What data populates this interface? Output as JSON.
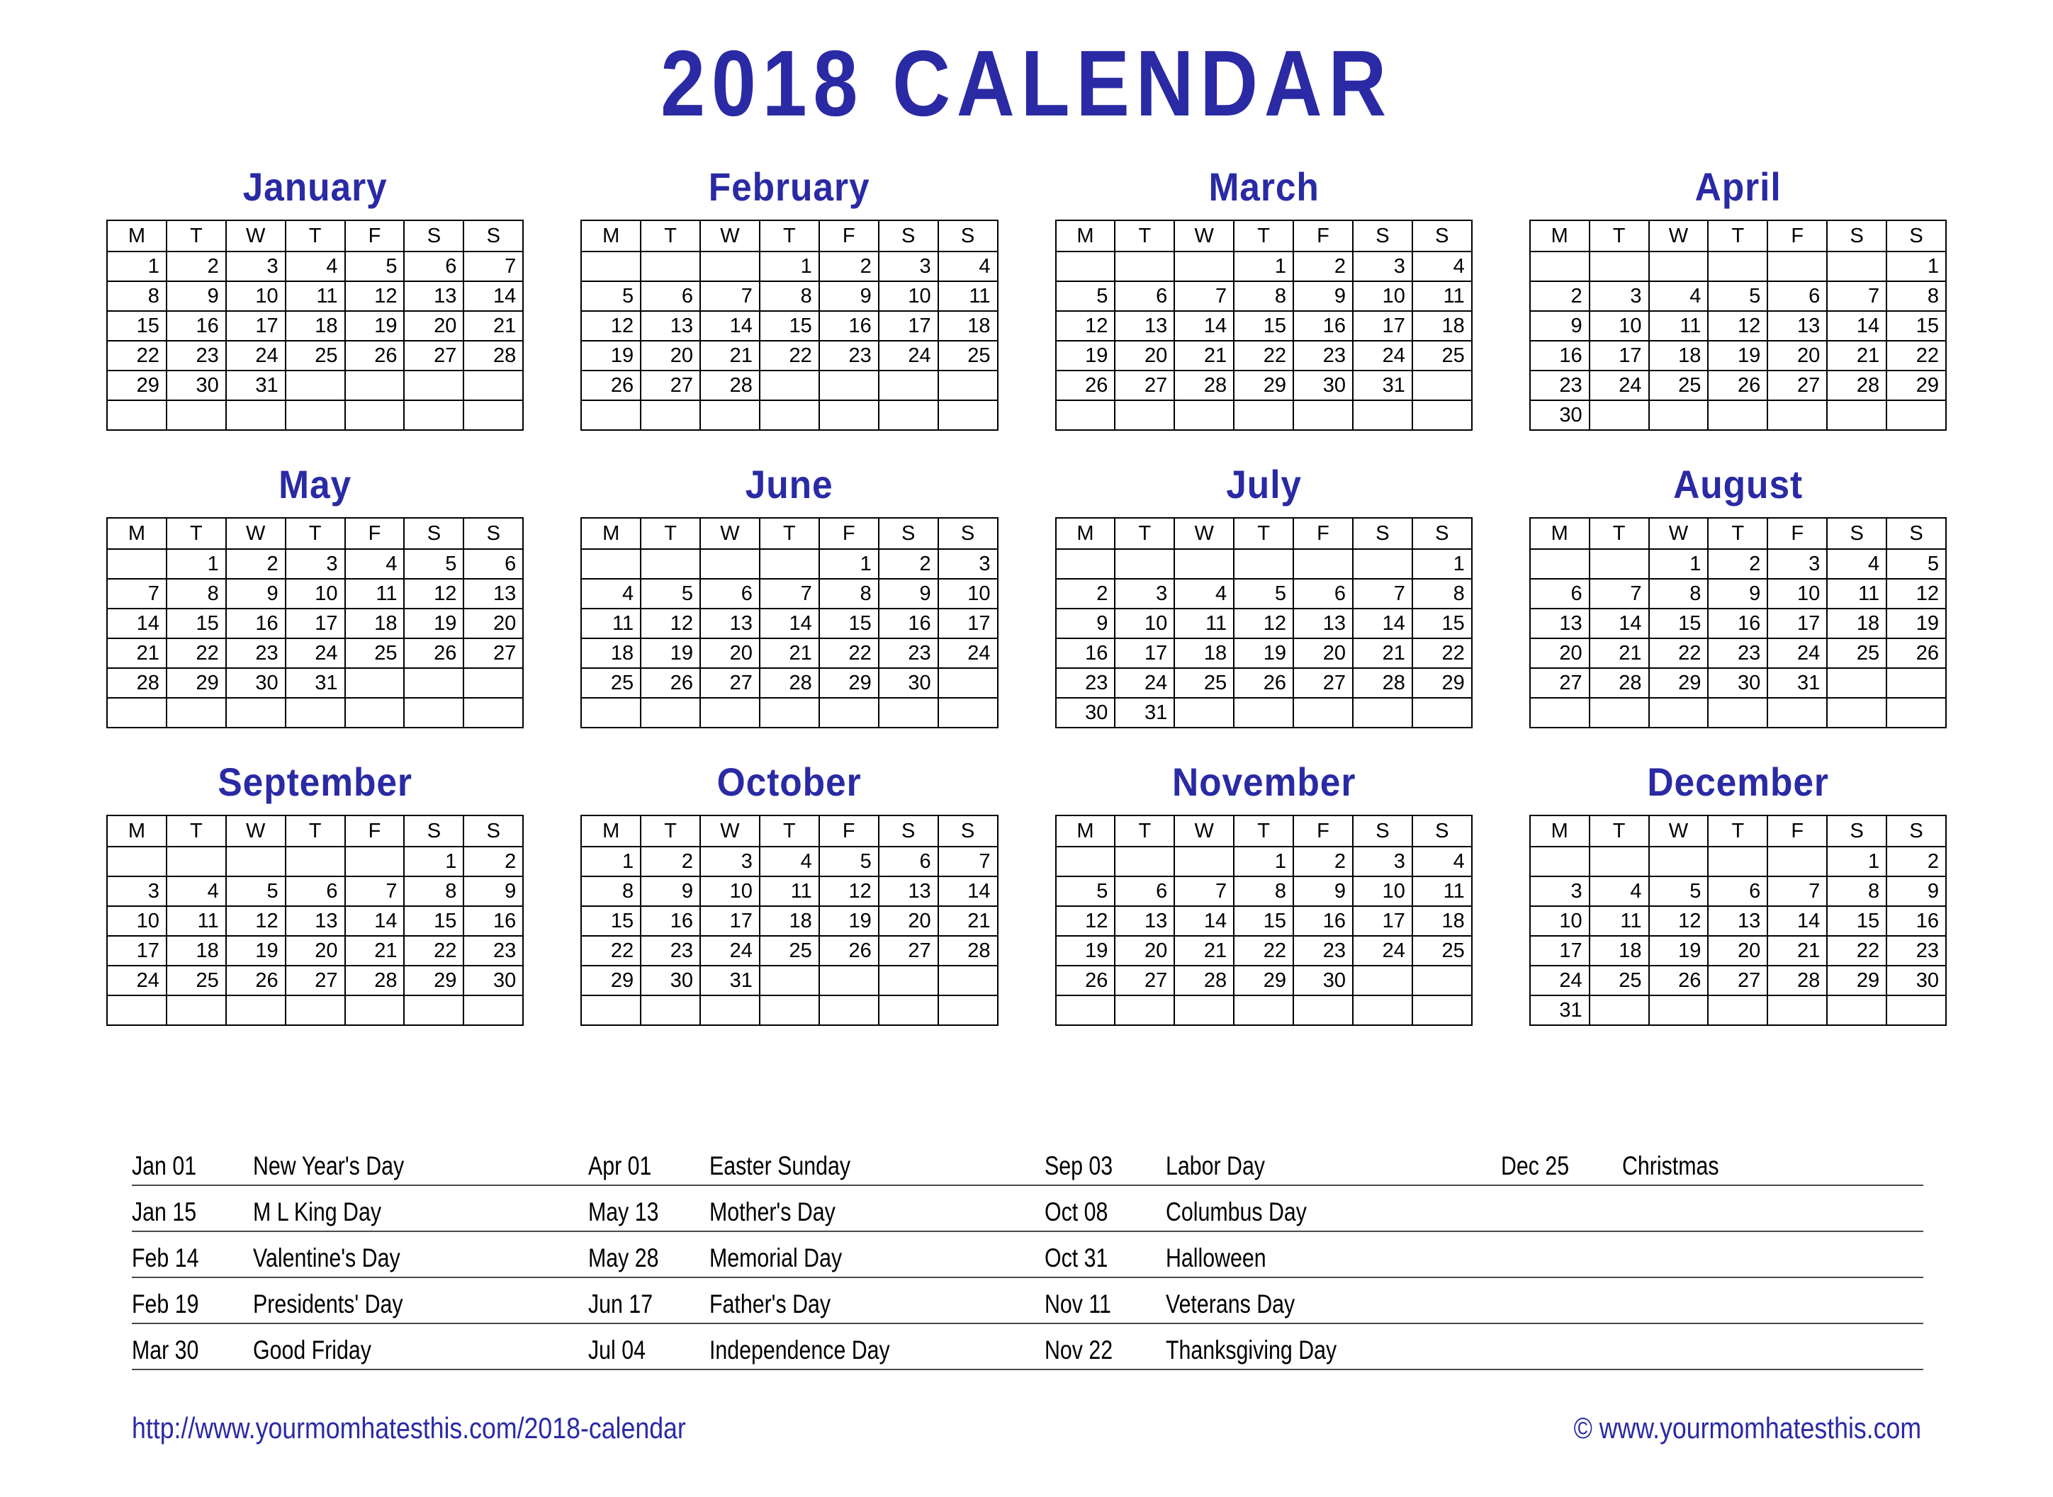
{
  "title": "2018 CALENDAR",
  "weekday_headers": [
    "M",
    "T",
    "W",
    "T",
    "F",
    "S",
    "S"
  ],
  "accent_color": "#2A2AA5",
  "border_color": "#000000",
  "months": [
    {
      "name": "January",
      "weeks": [
        [
          "1",
          "2",
          "3",
          "4",
          "5",
          "6",
          "7"
        ],
        [
          "8",
          "9",
          "10",
          "11",
          "12",
          "13",
          "14"
        ],
        [
          "15",
          "16",
          "17",
          "18",
          "19",
          "20",
          "21"
        ],
        [
          "22",
          "23",
          "24",
          "25",
          "26",
          "27",
          "28"
        ],
        [
          "29",
          "30",
          "31",
          "",
          "",
          "",
          ""
        ],
        [
          "",
          "",
          "",
          "",
          "",
          "",
          ""
        ]
      ]
    },
    {
      "name": "February",
      "weeks": [
        [
          "",
          "",
          "",
          "1",
          "2",
          "3",
          "4"
        ],
        [
          "5",
          "6",
          "7",
          "8",
          "9",
          "10",
          "11"
        ],
        [
          "12",
          "13",
          "14",
          "15",
          "16",
          "17",
          "18"
        ],
        [
          "19",
          "20",
          "21",
          "22",
          "23",
          "24",
          "25"
        ],
        [
          "26",
          "27",
          "28",
          "",
          "",
          "",
          ""
        ],
        [
          "",
          "",
          "",
          "",
          "",
          "",
          ""
        ]
      ]
    },
    {
      "name": "March",
      "weeks": [
        [
          "",
          "",
          "",
          "1",
          "2",
          "3",
          "4"
        ],
        [
          "5",
          "6",
          "7",
          "8",
          "9",
          "10",
          "11"
        ],
        [
          "12",
          "13",
          "14",
          "15",
          "16",
          "17",
          "18"
        ],
        [
          "19",
          "20",
          "21",
          "22",
          "23",
          "24",
          "25"
        ],
        [
          "26",
          "27",
          "28",
          "29",
          "30",
          "31",
          ""
        ],
        [
          "",
          "",
          "",
          "",
          "",
          "",
          ""
        ]
      ]
    },
    {
      "name": "April",
      "weeks": [
        [
          "",
          "",
          "",
          "",
          "",
          "",
          "1"
        ],
        [
          "2",
          "3",
          "4",
          "5",
          "6",
          "7",
          "8"
        ],
        [
          "9",
          "10",
          "11",
          "12",
          "13",
          "14",
          "15"
        ],
        [
          "16",
          "17",
          "18",
          "19",
          "20",
          "21",
          "22"
        ],
        [
          "23",
          "24",
          "25",
          "26",
          "27",
          "28",
          "29"
        ],
        [
          "30",
          "",
          "",
          "",
          "",
          "",
          ""
        ]
      ]
    },
    {
      "name": "May",
      "weeks": [
        [
          "",
          "1",
          "2",
          "3",
          "4",
          "5",
          "6"
        ],
        [
          "7",
          "8",
          "9",
          "10",
          "11",
          "12",
          "13"
        ],
        [
          "14",
          "15",
          "16",
          "17",
          "18",
          "19",
          "20"
        ],
        [
          "21",
          "22",
          "23",
          "24",
          "25",
          "26",
          "27"
        ],
        [
          "28",
          "29",
          "30",
          "31",
          "",
          "",
          ""
        ],
        [
          "",
          "",
          "",
          "",
          "",
          "",
          ""
        ]
      ]
    },
    {
      "name": "June",
      "weeks": [
        [
          "",
          "",
          "",
          "",
          "1",
          "2",
          "3"
        ],
        [
          "4",
          "5",
          "6",
          "7",
          "8",
          "9",
          "10"
        ],
        [
          "11",
          "12",
          "13",
          "14",
          "15",
          "16",
          "17"
        ],
        [
          "18",
          "19",
          "20",
          "21",
          "22",
          "23",
          "24"
        ],
        [
          "25",
          "26",
          "27",
          "28",
          "29",
          "30",
          ""
        ],
        [
          "",
          "",
          "",
          "",
          "",
          "",
          ""
        ]
      ]
    },
    {
      "name": "July",
      "weeks": [
        [
          "",
          "",
          "",
          "",
          "",
          "",
          "1"
        ],
        [
          "2",
          "3",
          "4",
          "5",
          "6",
          "7",
          "8"
        ],
        [
          "9",
          "10",
          "11",
          "12",
          "13",
          "14",
          "15"
        ],
        [
          "16",
          "17",
          "18",
          "19",
          "20",
          "21",
          "22"
        ],
        [
          "23",
          "24",
          "25",
          "26",
          "27",
          "28",
          "29"
        ],
        [
          "30",
          "31",
          "",
          "",
          "",
          "",
          ""
        ]
      ]
    },
    {
      "name": "August",
      "weeks": [
        [
          "",
          "",
          "1",
          "2",
          "3",
          "4",
          "5"
        ],
        [
          "6",
          "7",
          "8",
          "9",
          "10",
          "11",
          "12"
        ],
        [
          "13",
          "14",
          "15",
          "16",
          "17",
          "18",
          "19"
        ],
        [
          "20",
          "21",
          "22",
          "23",
          "24",
          "25",
          "26"
        ],
        [
          "27",
          "28",
          "29",
          "30",
          "31",
          "",
          ""
        ],
        [
          "",
          "",
          "",
          "",
          "",
          "",
          ""
        ]
      ]
    },
    {
      "name": "September",
      "weeks": [
        [
          "",
          "",
          "",
          "",
          "",
          "1",
          "2"
        ],
        [
          "3",
          "4",
          "5",
          "6",
          "7",
          "8",
          "9"
        ],
        [
          "10",
          "11",
          "12",
          "13",
          "14",
          "15",
          "16"
        ],
        [
          "17",
          "18",
          "19",
          "20",
          "21",
          "22",
          "23"
        ],
        [
          "24",
          "25",
          "26",
          "27",
          "28",
          "29",
          "30"
        ],
        [
          "",
          "",
          "",
          "",
          "",
          "",
          ""
        ]
      ]
    },
    {
      "name": "October",
      "weeks": [
        [
          "1",
          "2",
          "3",
          "4",
          "5",
          "6",
          "7"
        ],
        [
          "8",
          "9",
          "10",
          "11",
          "12",
          "13",
          "14"
        ],
        [
          "15",
          "16",
          "17",
          "18",
          "19",
          "20",
          "21"
        ],
        [
          "22",
          "23",
          "24",
          "25",
          "26",
          "27",
          "28"
        ],
        [
          "29",
          "30",
          "31",
          "",
          "",
          "",
          ""
        ],
        [
          "",
          "",
          "",
          "",
          "",
          "",
          ""
        ]
      ]
    },
    {
      "name": "November",
      "weeks": [
        [
          "",
          "",
          "",
          "1",
          "2",
          "3",
          "4"
        ],
        [
          "5",
          "6",
          "7",
          "8",
          "9",
          "10",
          "11"
        ],
        [
          "12",
          "13",
          "14",
          "15",
          "16",
          "17",
          "18"
        ],
        [
          "19",
          "20",
          "21",
          "22",
          "23",
          "24",
          "25"
        ],
        [
          "26",
          "27",
          "28",
          "29",
          "30",
          "",
          ""
        ],
        [
          "",
          "",
          "",
          "",
          "",
          "",
          ""
        ]
      ]
    },
    {
      "name": "December",
      "weeks": [
        [
          "",
          "",
          "",
          "",
          "",
          "1",
          "2"
        ],
        [
          "3",
          "4",
          "5",
          "6",
          "7",
          "8",
          "9"
        ],
        [
          "10",
          "11",
          "12",
          "13",
          "14",
          "15",
          "16"
        ],
        [
          "17",
          "18",
          "19",
          "20",
          "21",
          "22",
          "23"
        ],
        [
          "24",
          "25",
          "26",
          "27",
          "28",
          "29",
          "30"
        ],
        [
          "31",
          "",
          "",
          "",
          "",
          "",
          ""
        ]
      ]
    }
  ],
  "holidays": {
    "rows": [
      [
        {
          "date": "Jan 01",
          "name": "New Year's Day"
        },
        {
          "date": "Apr 01",
          "name": "Easter Sunday"
        },
        {
          "date": "Sep 03",
          "name": "Labor Day"
        },
        {
          "date": "Dec 25",
          "name": "Christmas"
        }
      ],
      [
        {
          "date": "Jan 15",
          "name": "M L King Day"
        },
        {
          "date": "May 13",
          "name": "Mother's Day"
        },
        {
          "date": "Oct 08",
          "name": "Columbus Day"
        },
        {
          "date": "",
          "name": ""
        }
      ],
      [
        {
          "date": "Feb 14",
          "name": "Valentine's Day"
        },
        {
          "date": "May 28",
          "name": "Memorial Day"
        },
        {
          "date": "Oct 31",
          "name": "Halloween"
        },
        {
          "date": "",
          "name": ""
        }
      ],
      [
        {
          "date": "Feb 19",
          "name": "Presidents' Day"
        },
        {
          "date": "Jun 17",
          "name": "Father's Day"
        },
        {
          "date": "Nov 11",
          "name": "Veterans Day"
        },
        {
          "date": "",
          "name": ""
        }
      ],
      [
        {
          "date": "Mar 30",
          "name": "Good Friday"
        },
        {
          "date": "Jul 04",
          "name": "Independence Day"
        },
        {
          "date": "Nov 22",
          "name": "Thanksgiving Day"
        },
        {
          "date": "",
          "name": ""
        }
      ]
    ]
  },
  "footer": {
    "url": "http://www.yourmomhatesthis.com/2018-calendar",
    "copyright": "© www.yourmomhatesthis.com"
  }
}
